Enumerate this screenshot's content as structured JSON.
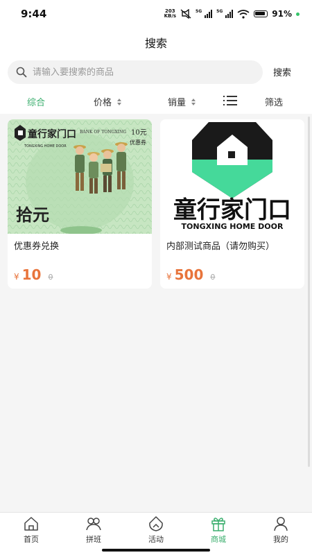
{
  "status_bar": {
    "time": "9:44",
    "net_speed_value": "203",
    "net_speed_unit": "KB/s",
    "sim1_label": "5G",
    "sim2_label": "5G",
    "battery_percent": "91%"
  },
  "header": {
    "title": "搜索"
  },
  "search": {
    "placeholder": "请输入要搜索的商品",
    "value": "",
    "button_label": "搜索"
  },
  "filters": {
    "items": [
      {
        "label": "综合",
        "active": true
      },
      {
        "label": "价格",
        "sortable": true
      },
      {
        "label": "销量",
        "sortable": true
      },
      {
        "label": "",
        "icon": "list-view-icon"
      },
      {
        "label": "筛选"
      }
    ]
  },
  "products": [
    {
      "title": "优惠券兑换",
      "currency": "¥",
      "price": "10",
      "original_price": "0",
      "image": {
        "brand": "童行家门口",
        "brand_en": "TONGXING HOME DOOR",
        "bank": "BANK OF TONGXING",
        "face_value": "10元",
        "voucher_label": "优惠券",
        "amount_chinese": "拾元"
      }
    },
    {
      "title": "内部测试商品（请勿购买）",
      "currency": "¥",
      "price": "500",
      "original_price": "0",
      "image": {
        "brand": "童行家门口",
        "brand_en": "TONGXING HOME DOOR"
      }
    }
  ],
  "tabbar": {
    "items": [
      {
        "label": "首页",
        "icon": "home-icon"
      },
      {
        "label": "拼班",
        "icon": "group-icon"
      },
      {
        "label": "活动",
        "icon": "activity-icon"
      },
      {
        "label": "商城",
        "icon": "gift-icon",
        "active": true
      },
      {
        "label": "我的",
        "icon": "user-icon"
      }
    ]
  },
  "colors": {
    "accent": "#3aae6d",
    "price": "#e8743b",
    "brand_green": "#45d99a"
  }
}
